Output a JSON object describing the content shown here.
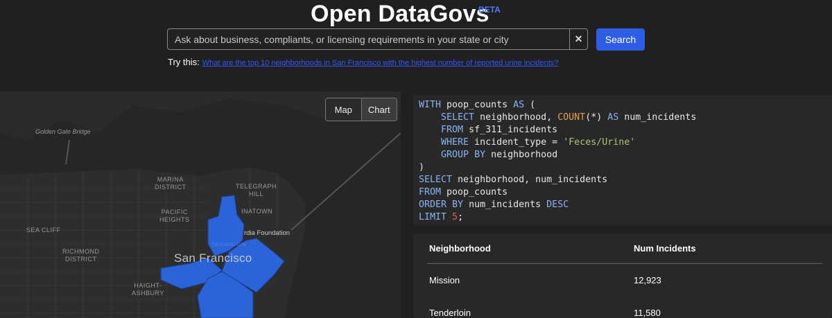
{
  "header": {
    "title": "Open DataGovs",
    "badge": "BETA"
  },
  "search": {
    "placeholder": "Ask about business, compliants, or licensing requirements in your state or city",
    "value": "",
    "clear_glyph": "✕",
    "button_label": "Search"
  },
  "suggestion": {
    "prefix": "Try this:",
    "link_text": "What are the top 10 neighborhoods in San Francisco with the highest number of reported urine incidents?"
  },
  "map": {
    "toggle": {
      "map_label": "Map",
      "chart_label": "Chart"
    },
    "labels": {
      "golden_gate": "Golden Gate Bridge",
      "marina": "MARINA\nDISTRICT",
      "telegraph": "TELEGRAPH\nHILL",
      "pacific": "PACIFIC\nHEIGHTS",
      "chinatown": "INATOWN",
      "sea_cliff": "SEA CLIFF",
      "richmond": "RICHMOND\nDISTRICT",
      "city": "San Francisco",
      "haight": "HAIGHT-\nASHBURY",
      "foundation": "rdia Foundation",
      "tenderloin": "TENDERLOIN"
    },
    "highlight_color": "#2b63d9"
  },
  "sql": {
    "lines": [
      [
        [
          "kw",
          "WITH "
        ],
        [
          "id",
          "poop_counts "
        ],
        [
          "kw",
          "AS "
        ],
        [
          "id",
          "("
        ]
      ],
      [
        [
          "id",
          "    "
        ],
        [
          "kw",
          "SELECT "
        ],
        [
          "id",
          "neighborhood, "
        ],
        [
          "fn",
          "COUNT"
        ],
        [
          "id",
          "(*) "
        ],
        [
          "kw",
          "AS "
        ],
        [
          "id",
          "num_incidents"
        ]
      ],
      [
        [
          "id",
          "    "
        ],
        [
          "kw",
          "FROM "
        ],
        [
          "id",
          "sf_311_incidents"
        ]
      ],
      [
        [
          "id",
          "    "
        ],
        [
          "kw",
          "WHERE "
        ],
        [
          "id",
          "incident_type = "
        ],
        [
          "str",
          "'Feces/Urine'"
        ]
      ],
      [
        [
          "id",
          "    "
        ],
        [
          "kw",
          "GROUP BY "
        ],
        [
          "id",
          "neighborhood"
        ]
      ],
      [
        [
          "id",
          ")"
        ]
      ],
      [
        [
          "kw",
          "SELECT "
        ],
        [
          "id",
          "neighborhood, num_incidents"
        ]
      ],
      [
        [
          "kw",
          "FROM "
        ],
        [
          "id",
          "poop_counts"
        ]
      ],
      [
        [
          "kw",
          "ORDER BY "
        ],
        [
          "id",
          "num_incidents "
        ],
        [
          "kw",
          "DESC"
        ]
      ],
      [
        [
          "kw",
          "LIMIT "
        ],
        [
          "num",
          "5"
        ],
        [
          "id",
          ";"
        ]
      ]
    ]
  },
  "results": {
    "columns": [
      "Neighborhood",
      "Num Incidents"
    ],
    "rows": [
      [
        "Mission",
        "12,923"
      ],
      [
        "Tenderloin",
        "11,580"
      ]
    ]
  }
}
